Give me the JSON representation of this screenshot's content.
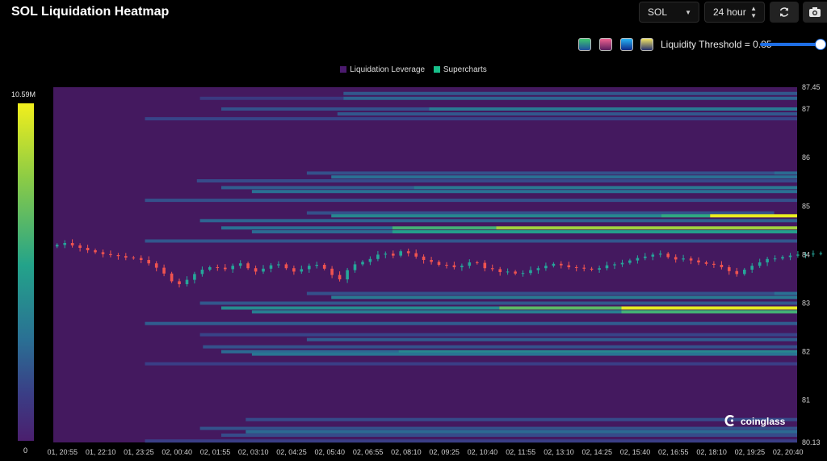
{
  "header": {
    "title": "SOL Liquidation Heatmap",
    "symbol_select": "SOL",
    "range_select": "24 hour",
    "refresh_icon": "refresh-icon",
    "camera_icon": "camera-icon"
  },
  "controls": {
    "threshold_label": "Liquidity Threshold = 0.85",
    "threshold_value": 0.85,
    "palettes": [
      {
        "name": "palette-green",
        "top": "#3cc86e",
        "bottom": "#1f4fa0"
      },
      {
        "name": "palette-pink",
        "top": "#f06292",
        "bottom": "#5a1e5c"
      },
      {
        "name": "palette-blue",
        "top": "#29b6f6",
        "bottom": "#0d2a8a"
      },
      {
        "name": "palette-yellow",
        "top": "#f5e663",
        "bottom": "#26326e"
      }
    ]
  },
  "legend": {
    "items": [
      {
        "label": "Liquidation Leverage",
        "color": "#4b1a6e"
      },
      {
        "label": "Supercharts",
        "color": "#18c08a"
      }
    ]
  },
  "color_scale": {
    "max_label": "10.59M",
    "min_label": "0"
  },
  "watermark": {
    "text": "coinglass"
  },
  "chart_data": {
    "type": "heatmap",
    "title": "SOL Liquidation Heatmap",
    "ylim": [
      80.13,
      87.45
    ],
    "y_ticks": [
      "87.45",
      "87",
      "86",
      "85",
      "84",
      "83",
      "82",
      "81",
      "80.13"
    ],
    "y_tick_values": [
      87.45,
      87,
      86,
      85,
      84,
      83,
      82,
      81,
      80.13
    ],
    "x_ticks": [
      "01, 20:55",
      "01, 22:10",
      "01, 23:25",
      "02, 00:40",
      "02, 01:55",
      "02, 03:10",
      "02, 04:25",
      "02, 05:40",
      "02, 06:55",
      "02, 08:10",
      "02, 09:25",
      "02, 10:40",
      "02, 11:55",
      "02, 13:10",
      "02, 14:25",
      "02, 15:40",
      "02, 16:55",
      "02, 18:10",
      "02, 19:25",
      "02, 20:40"
    ],
    "x_tick_hours": [
      0,
      1.25,
      2.5,
      3.75,
      5,
      6.25,
      7.5,
      8.75,
      10,
      11.25,
      12.5,
      13.75,
      15,
      16.25,
      17.5,
      18.75,
      20,
      21.25,
      22.5,
      23.75
    ],
    "xlim_hours": [
      -0.3,
      24.05
    ],
    "colorbar_range": [
      0,
      10.59
    ],
    "background_color": "#44195f",
    "levels": [
      {
        "price": 87.32,
        "segments": [
          [
            9.2,
            24.05,
            0.22
          ]
        ]
      },
      {
        "price": 87.22,
        "segments": [
          [
            4.5,
            9.2,
            0.12
          ],
          [
            9.2,
            24.05,
            0.26
          ]
        ]
      },
      {
        "price": 87.0,
        "segments": [
          [
            5.2,
            12.0,
            0.2
          ],
          [
            12.0,
            24.05,
            0.34
          ]
        ]
      },
      {
        "price": 86.9,
        "segments": [
          [
            9.0,
            24.05,
            0.22
          ]
        ]
      },
      {
        "price": 86.8,
        "segments": [
          [
            2.7,
            24.05,
            0.16
          ]
        ]
      },
      {
        "price": 85.68,
        "segments": [
          [
            8.0,
            23.3,
            0.2
          ],
          [
            23.3,
            24.05,
            0.28
          ]
        ]
      },
      {
        "price": 85.6,
        "segments": [
          [
            8.8,
            24.05,
            0.3
          ]
        ]
      },
      {
        "price": 85.52,
        "segments": [
          [
            4.4,
            24.05,
            0.18
          ]
        ]
      },
      {
        "price": 85.38,
        "segments": [
          [
            5.2,
            11.5,
            0.24
          ],
          [
            11.5,
            24.05,
            0.34
          ]
        ]
      },
      {
        "price": 85.3,
        "segments": [
          [
            6.2,
            24.05,
            0.3
          ]
        ]
      },
      {
        "price": 85.12,
        "segments": [
          [
            2.7,
            24.05,
            0.2
          ]
        ]
      },
      {
        "price": 84.86,
        "segments": [
          [
            8.0,
            23.3,
            0.2
          ]
        ]
      },
      {
        "price": 84.8,
        "segments": [
          [
            8.8,
            19.6,
            0.4
          ],
          [
            19.6,
            21.2,
            0.55
          ],
          [
            21.2,
            24.05,
            0.98
          ]
        ]
      },
      {
        "price": 84.7,
        "segments": [
          [
            4.5,
            24.05,
            0.26
          ]
        ]
      },
      {
        "price": 84.55,
        "segments": [
          [
            5.2,
            10.8,
            0.3
          ],
          [
            10.8,
            14.2,
            0.6
          ],
          [
            14.2,
            24.05,
            0.82
          ]
        ]
      },
      {
        "price": 84.47,
        "segments": [
          [
            6.2,
            10.8,
            0.28
          ],
          [
            10.8,
            24.05,
            0.5
          ]
        ]
      },
      {
        "price": 84.28,
        "segments": [
          [
            2.7,
            24.05,
            0.22
          ]
        ]
      },
      {
        "price": 83.2,
        "segments": [
          [
            8.0,
            23.3,
            0.2
          ],
          [
            23.3,
            24.05,
            0.3
          ]
        ]
      },
      {
        "price": 83.12,
        "segments": [
          [
            8.8,
            24.05,
            0.34
          ]
        ]
      },
      {
        "price": 83.0,
        "segments": [
          [
            4.5,
            24.05,
            0.22
          ]
        ]
      },
      {
        "price": 82.9,
        "segments": [
          [
            5.2,
            14.3,
            0.42
          ],
          [
            14.3,
            18.3,
            0.66
          ],
          [
            18.3,
            24.05,
            0.97
          ]
        ]
      },
      {
        "price": 82.82,
        "segments": [
          [
            6.2,
            18.3,
            0.36
          ],
          [
            18.3,
            24.05,
            0.6
          ]
        ]
      },
      {
        "price": 82.58,
        "segments": [
          [
            2.7,
            24.05,
            0.24
          ]
        ]
      },
      {
        "price": 82.35,
        "segments": [
          [
            4.5,
            24.05,
            0.16
          ]
        ]
      },
      {
        "price": 82.25,
        "segments": [
          [
            8.0,
            24.05,
            0.24
          ]
        ]
      },
      {
        "price": 82.1,
        "segments": [
          [
            4.6,
            24.05,
            0.2
          ]
        ]
      },
      {
        "price": 82.0,
        "segments": [
          [
            5.2,
            11.0,
            0.28
          ],
          [
            11.0,
            24.05,
            0.4
          ]
        ]
      },
      {
        "price": 81.95,
        "segments": [
          [
            6.2,
            24.05,
            0.32
          ]
        ]
      },
      {
        "price": 81.75,
        "segments": [
          [
            2.7,
            24.05,
            0.14
          ]
        ]
      },
      {
        "price": 80.6,
        "segments": [
          [
            6.0,
            24.05,
            0.18
          ]
        ]
      },
      {
        "price": 80.42,
        "segments": [
          [
            4.5,
            24.05,
            0.2
          ]
        ]
      },
      {
        "price": 80.35,
        "segments": [
          [
            6.0,
            24.05,
            0.28
          ]
        ]
      },
      {
        "price": 80.28,
        "segments": [
          [
            5.2,
            24.05,
            0.18
          ]
        ]
      },
      {
        "price": 80.16,
        "segments": [
          [
            2.7,
            24.05,
            0.14
          ]
        ]
      }
    ],
    "price_path": {
      "interval_minutes": 15,
      "start_hours": -0.3,
      "close": [
        84.2,
        84.24,
        84.19,
        84.14,
        84.09,
        84.05,
        84.01,
        83.99,
        83.97,
        83.94,
        83.93,
        83.89,
        83.82,
        83.73,
        83.61,
        83.45,
        83.39,
        83.48,
        83.6,
        83.69,
        83.74,
        83.73,
        83.7,
        83.77,
        83.82,
        83.72,
        83.65,
        83.71,
        83.78,
        83.8,
        83.72,
        83.65,
        83.7,
        83.77,
        83.79,
        83.71,
        83.58,
        83.49,
        83.68,
        83.8,
        83.85,
        83.91,
        84.0,
        84.02,
        83.98,
        84.07,
        84.03,
        83.96,
        83.89,
        83.85,
        83.79,
        83.78,
        83.74,
        83.77,
        83.84,
        83.83,
        83.72,
        83.7,
        83.64,
        83.65,
        83.61,
        83.62,
        83.68,
        83.72,
        83.77,
        83.81,
        83.78,
        83.74,
        83.73,
        83.71,
        83.69,
        83.72,
        83.78,
        83.8,
        83.83,
        83.88,
        83.93,
        83.96,
        84.0,
        84.02,
        83.95,
        83.9,
        83.92,
        83.88,
        83.84,
        83.81,
        83.79,
        83.74,
        83.66,
        83.6,
        83.69,
        83.77,
        83.84,
        83.91,
        83.92,
        83.95,
        83.98,
        84.0,
        84.01,
        84.02,
        84.03,
        84.03,
        84.04,
        84.07,
        84.1,
        84.16,
        84.17,
        84.12,
        84.09,
        84.06,
        84.03,
        83.99,
        83.96
      ]
    }
  }
}
